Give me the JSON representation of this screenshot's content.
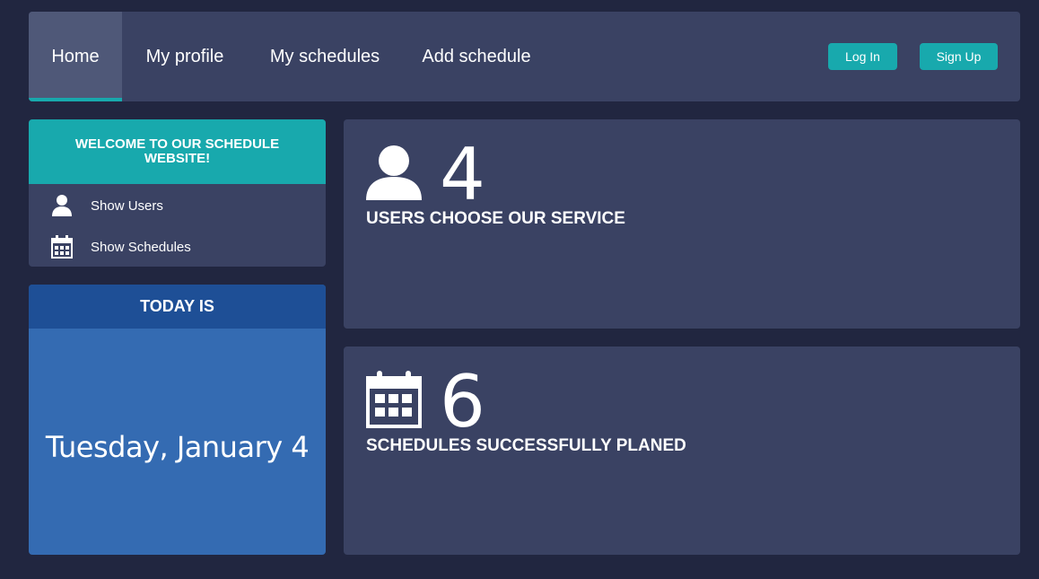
{
  "nav": {
    "items": [
      {
        "label": "Home",
        "active": true
      },
      {
        "label": "My profile"
      },
      {
        "label": "My schedules"
      },
      {
        "label": "Add schedule"
      }
    ],
    "login_label": "Log In",
    "signup_label": "Sign Up"
  },
  "sidebar": {
    "welcome_title": "WELCOME TO OUR SCHEDULE WEBSITE!",
    "items": [
      {
        "label": "Show Users",
        "icon": "user-icon"
      },
      {
        "label": "Show Schedules",
        "icon": "calendar-icon"
      }
    ]
  },
  "today": {
    "heading": "TODAY IS",
    "date": "Tuesday, January 4"
  },
  "stats": [
    {
      "count": "4",
      "label": "USERS CHOOSE OUR SERVICE",
      "icon": "user-icon"
    },
    {
      "count": "6",
      "label": "SCHEDULES SUCCESSFULLY PLANED",
      "icon": "calendar-icon"
    }
  ],
  "colors": {
    "background": "#212640",
    "panel": "#3a4263",
    "accent": "#18a9ad",
    "today_header": "#1e4f96",
    "today_body": "#346bb2"
  }
}
